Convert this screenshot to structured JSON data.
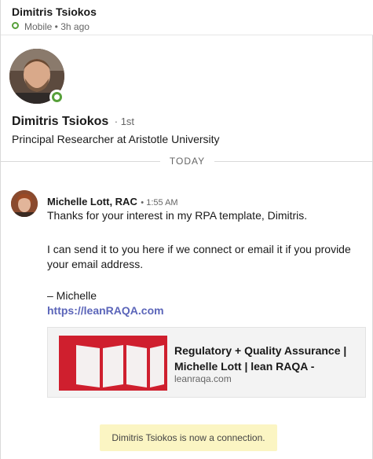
{
  "header": {
    "name": "Dimitris Tsiokos",
    "status": "Mobile • 3h ago"
  },
  "profile": {
    "name": "Dimitris Tsiokos",
    "degree": "· 1st",
    "headline": "Principal Researcher at Aristotle University"
  },
  "divider": {
    "label": "TODAY"
  },
  "message": {
    "sender": "Michelle Lott, RAC",
    "time": "• 1:55 AM",
    "lines": [
      "Thanks for your interest in my RPA template, Dimitris.",
      "I can send it to you here if we connect or email it if you provide",
      "your email address.",
      "– Michelle"
    ],
    "link": "https://leanRAQA.com",
    "preview": {
      "title_line1": "Regulatory + Quality Assurance |",
      "title_line2": "Michelle Lott | lean RAQA -",
      "domain": "leanraqa.com"
    }
  },
  "system_notice": "Dimitris Tsiokos is now a connection.",
  "colors": {
    "presence_green": "#57a03a",
    "link_blue": "#5b65b9",
    "notice_yellow": "#fbf5c3",
    "brand_red": "#cf1f2e"
  }
}
